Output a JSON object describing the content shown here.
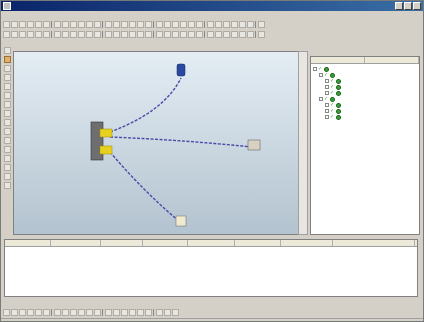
{
  "window": {
    "title": "",
    "controls": [
      "minimize-icon",
      "maximize-icon",
      "close-icon"
    ]
  },
  "menu": [
    "",
    "",
    "",
    "",
    "",
    "",
    "",
    "",
    "",
    "",
    "",
    ""
  ],
  "device_tree": {
    "columns": [
      "",
      ""
    ],
    "rows": [
      {
        "label": "",
        "connector": ""
      },
      {
        "label": "",
        "connector": ""
      },
      {
        "label": "",
        "connector": ""
      },
      {
        "label": "",
        "connector": ""
      },
      {
        "label": "",
        "connector": ""
      },
      {
        "label": "",
        "connector": ""
      },
      {
        "label": "",
        "connector": ""
      },
      {
        "label": "",
        "connector": ""
      },
      {
        "label": "",
        "connector": ""
      }
    ]
  },
  "wire_table": {
    "columns": [
      "",
      "",
      "",
      "",
      "",
      "",
      "",
      ""
    ],
    "rows": [
      {
        "c1": "",
        "c2": "",
        "c3": "",
        "c4": "",
        "c5": "",
        "c6": "",
        "c7": "",
        "c8": ""
      },
      {
        "c1": "",
        "c2": "",
        "c3": "",
        "c4": "",
        "c5": "",
        "c6": "",
        "c7": "",
        "c8": ""
      },
      {
        "c1": "",
        "c2": "",
        "c3": "",
        "c4": "",
        "c5": "",
        "c6": "",
        "c7": "",
        "c8": ""
      },
      {
        "c1": "",
        "c2": "",
        "c3": "",
        "c4": "",
        "c5": "",
        "c6": "",
        "c7": "",
        "c8": ""
      },
      {
        "c1": "",
        "c2": "",
        "c3": "",
        "c4": "",
        "c5": "",
        "c6": "",
        "c7": "",
        "c8": ""
      },
      {
        "c1": "",
        "c2": "",
        "c3": "",
        "c4": "",
        "c5": "",
        "c6": "",
        "c7": "",
        "c8": ""
      },
      {
        "c1": "",
        "c2": "",
        "c3": "",
        "c4": "",
        "c5": "",
        "c6": "",
        "c7": "",
        "c8": ""
      },
      {
        "c1": "",
        "c2": "",
        "c3": "",
        "c4": "",
        "c5": "",
        "c6": "",
        "c7": "",
        "c8": ""
      }
    ]
  },
  "icons": {
    "window": "app-icon",
    "tree_expand": "plus-box-icon",
    "tree_check": "checkmark-icon",
    "tree_node": "node-icon"
  },
  "colors": {
    "titlebar": "#0a246a",
    "wire": "#4a4aa8",
    "device_yellow": "#e8d020",
    "viewport_top": "#e4edf4",
    "viewport_bottom": "#b3c3cf"
  }
}
